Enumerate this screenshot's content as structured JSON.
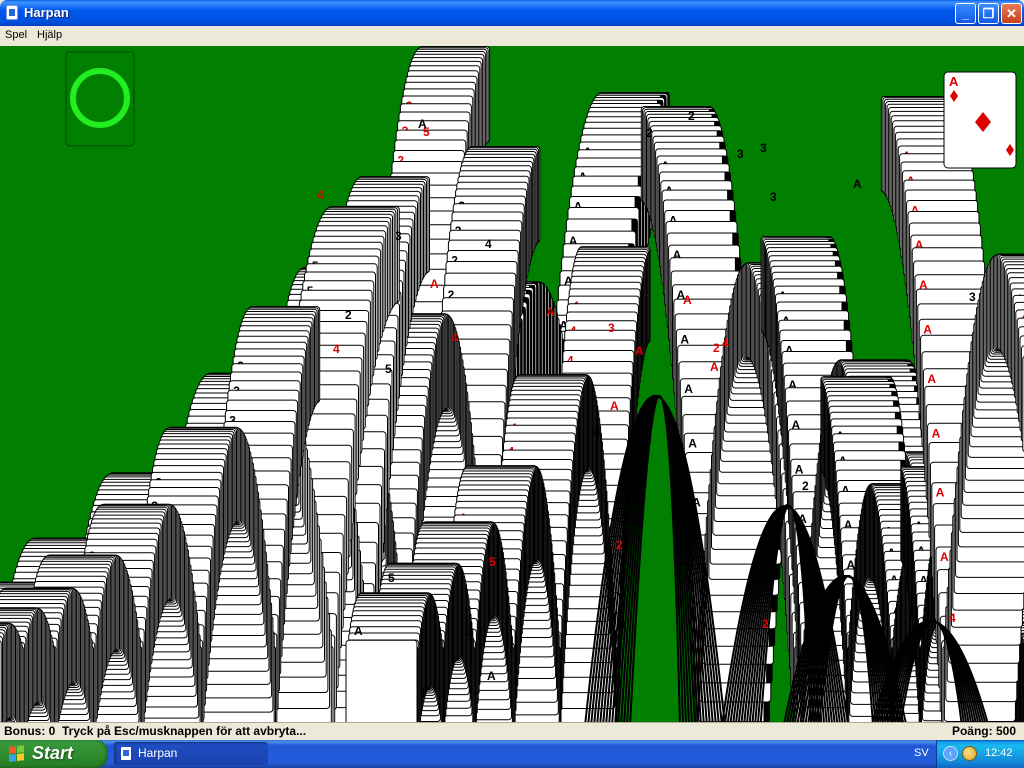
{
  "window": {
    "title": "Harpan",
    "menu": [
      "Spel",
      "Hjälp"
    ],
    "buttons": {
      "minimize": "_",
      "maximize": "❐",
      "close": "✕"
    }
  },
  "game": {
    "felt_color": "#007f00",
    "cascade_ranks": [
      "A",
      "2",
      "3",
      "4",
      "5"
    ],
    "suits": [
      "spades",
      "diamonds"
    ],
    "top_right_card": {
      "rank": "A",
      "suit": "diamonds"
    },
    "stock_indicator": "empty-circle"
  },
  "status": {
    "left": "Bonus: 0  Tryck på Esc/musknappen för att avbryta...",
    "right": "Poäng: 500"
  },
  "taskbar": {
    "start_label": "Start",
    "task": "Harpan",
    "language": "SV",
    "clock": "12:42"
  }
}
